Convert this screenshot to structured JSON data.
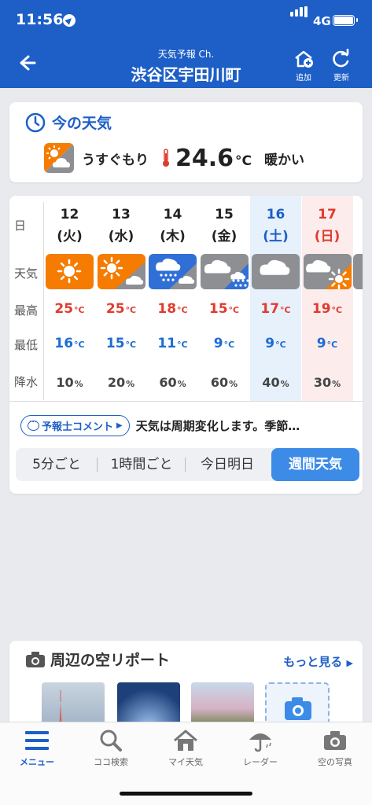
{
  "status_bar": {
    "time": "11:56",
    "network": "4G"
  },
  "header": {
    "subtitle": "天気予報 Ch.",
    "title": "渋谷区宇田川町",
    "add_label": "追加",
    "refresh_label": "更新"
  },
  "current": {
    "heading": "今の天気",
    "condition": "うすぐもり",
    "temperature": "24.6",
    "unit": "°C",
    "feeling": "暖かい"
  },
  "forecast": {
    "row_labels": {
      "day": "日",
      "weather": "天気",
      "high": "最高",
      "low": "最低",
      "precip": "降水"
    },
    "temp_unit": "°C",
    "precip_unit": "%",
    "days": [
      {
        "date": "12",
        "dow": "(火)",
        "icon": "sunny",
        "high": "25",
        "low": "16",
        "precip": "10",
        "type": "weekday"
      },
      {
        "date": "13",
        "dow": "(水)",
        "icon": "sunny-then-cloudy",
        "high": "25",
        "low": "15",
        "precip": "20",
        "type": "weekday"
      },
      {
        "date": "14",
        "dow": "(木)",
        "icon": "rain-then-cloudy",
        "high": "18",
        "low": "11",
        "precip": "60",
        "type": "weekday"
      },
      {
        "date": "15",
        "dow": "(金)",
        "icon": "cloudy-then-rain",
        "high": "15",
        "low": "9",
        "precip": "60",
        "type": "weekday"
      },
      {
        "date": "16",
        "dow": "(土)",
        "icon": "cloudy",
        "high": "17",
        "low": "9",
        "precip": "40",
        "type": "sat"
      },
      {
        "date": "17",
        "dow": "(日)",
        "icon": "cloudy-then-sunny",
        "high": "19",
        "low": "9",
        "precip": "30",
        "type": "sun"
      }
    ],
    "comment_button": "予報士コメント",
    "comment_text": "天気は周期変化します。季節…",
    "tabs": [
      "5分ごと",
      "1時間ごと",
      "今日明日",
      "週間天気"
    ],
    "active_tab": "週間天気"
  },
  "report": {
    "heading": "周辺の空リポート",
    "more": "もっと見る"
  },
  "tabbar": [
    {
      "label": "メニュー",
      "icon": "menu-icon",
      "active": true
    },
    {
      "label": "ココ検索",
      "icon": "search-icon",
      "active": false
    },
    {
      "label": "マイ天気",
      "icon": "home-icon",
      "active": false
    },
    {
      "label": "レーダー",
      "icon": "umbrella-icon",
      "active": false
    },
    {
      "label": "空の写真",
      "icon": "camera-icon",
      "active": false
    }
  ],
  "colors": {
    "brand_blue": "#1d5fc7",
    "hot_red": "#e03b2e",
    "cold_blue": "#1d6cd3",
    "sunny_orange": "#f57c00",
    "cloud_gray": "#8d8f93",
    "rain_blue": "#2f6fd6"
  }
}
